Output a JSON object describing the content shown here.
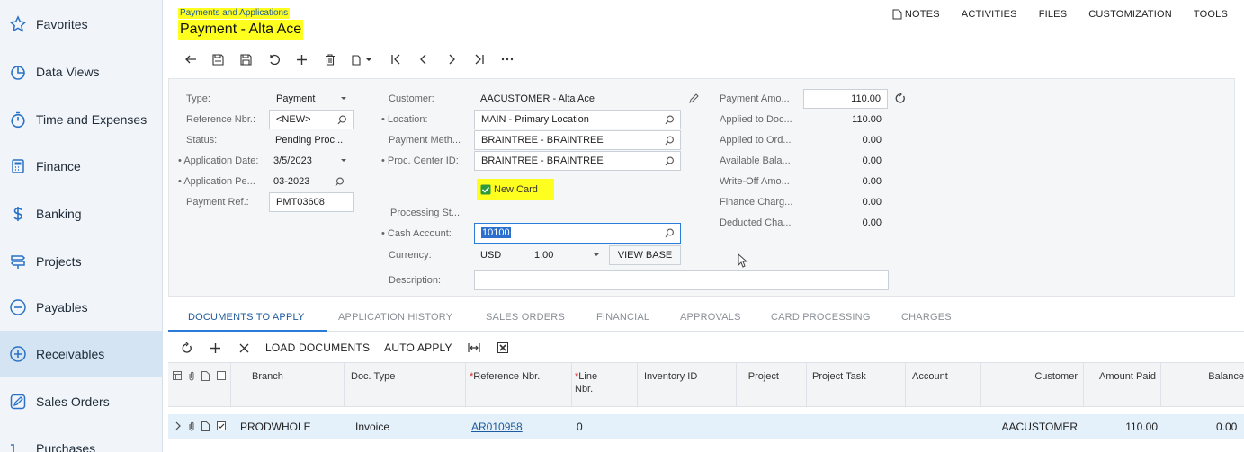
{
  "sidebar": {
    "items": [
      {
        "label": "Favorites",
        "icon": "star-icon"
      },
      {
        "label": "Data Views",
        "icon": "pie-chart-icon"
      },
      {
        "label": "Time and Expenses",
        "icon": "stopwatch-icon"
      },
      {
        "label": "Finance",
        "icon": "calculator-icon"
      },
      {
        "label": "Banking",
        "icon": "dollar-icon"
      },
      {
        "label": "Projects",
        "icon": "signpost-icon"
      },
      {
        "label": "Payables",
        "icon": "minus-circle-icon"
      },
      {
        "label": "Receivables",
        "icon": "plus-circle-icon",
        "active": true
      },
      {
        "label": "Sales Orders",
        "icon": "pencil-box-icon"
      },
      {
        "label": "Purchases",
        "icon": "cart-icon"
      }
    ]
  },
  "header": {
    "breadcrumb": "Payments and Applications",
    "title": "Payment - Alta Ace",
    "links": [
      "NOTES",
      "ACTIVITIES",
      "FILES",
      "CUSTOMIZATION",
      "TOOLS"
    ]
  },
  "toolbar": {
    "buttons": [
      "back-icon",
      "save-close-icon",
      "save-icon",
      "undo-icon",
      "add-icon",
      "delete-icon",
      "copy-icon",
      "first-icon",
      "previous-icon",
      "next-icon",
      "last-icon",
      "more-icon"
    ]
  },
  "form": {
    "type_label": "Type:",
    "type_value": "Payment",
    "refnbr_label": "Reference Nbr.:",
    "refnbr_value": "<NEW>",
    "status_label": "Status:",
    "status_value": "Pending Proc...",
    "appdate_label": "Application Date:",
    "appdate_value": "3/5/2023",
    "appperiod_label": "Application Pe...",
    "appperiod_value": "03-2023",
    "payref_label": "Payment Ref.:",
    "payref_value": "PMT03608",
    "customer_label": "Customer:",
    "customer_value": "AACUSTOMER - Alta Ace",
    "location_label": "Location:",
    "location_value": "MAIN - Primary Location",
    "paymethod_label": "Payment Meth...",
    "paymethod_value": "BRAINTREE - BRAINTREE",
    "proccenter_label": "Proc. Center ID:",
    "proccenter_value": "BRAINTREE - BRAINTREE",
    "newcard_label": "New Card",
    "newcard_checked": true,
    "processing_label": "Processing St...",
    "cashaccount_label": "Cash Account:",
    "cashaccount_value": "10100",
    "currency_label": "Currency:",
    "currency_value": "USD",
    "rate_value": "1.00",
    "viewbase_label": "VIEW BASE",
    "description_label": "Description:",
    "description_value": "",
    "payment_amount_label": "Payment Amo...",
    "payment_amount_value": "110.00",
    "applied_doc_label": "Applied to Doc...",
    "applied_doc_value": "110.00",
    "applied_ord_label": "Applied to Ord...",
    "applied_ord_value": "0.00",
    "available_label": "Available Bala...",
    "available_value": "0.00",
    "writeoff_label": "Write-Off Amo...",
    "writeoff_value": "0.00",
    "finance_label": "Finance Charg...",
    "finance_value": "0.00",
    "deducted_label": "Deducted Cha...",
    "deducted_value": "0.00"
  },
  "tabs": [
    "DOCUMENTS TO APPLY",
    "APPLICATION HISTORY",
    "SALES ORDERS",
    "FINANCIAL",
    "APPROVALS",
    "CARD PROCESSING",
    "CHARGES"
  ],
  "grid_toolbar": {
    "load_documents": "LOAD DOCUMENTS",
    "auto_apply": "AUTO APPLY"
  },
  "grid": {
    "columns": {
      "branch": "Branch",
      "doc_type": "Doc. Type",
      "ref_nbr": "Reference Nbr.",
      "line_nbr": "Line Nbr.",
      "inventory_id": "Inventory ID",
      "project": "Project",
      "project_task": "Project Task",
      "account": "Account",
      "customer": "Customer",
      "amount_paid": "Amount Paid",
      "balance": "Balance"
    },
    "rows": [
      {
        "branch": "PRODWHOLE",
        "doc_type": "Invoice",
        "ref_nbr": "AR010958",
        "line_nbr": "0",
        "customer": "AACUSTOMER",
        "amount_paid": "110.00",
        "balance": "0.00"
      }
    ]
  },
  "colors": {
    "highlight": "#ffff1f",
    "accent": "#2b7bd8",
    "link": "#1e5a9c",
    "checkbox_green": "#2e9a3e"
  }
}
